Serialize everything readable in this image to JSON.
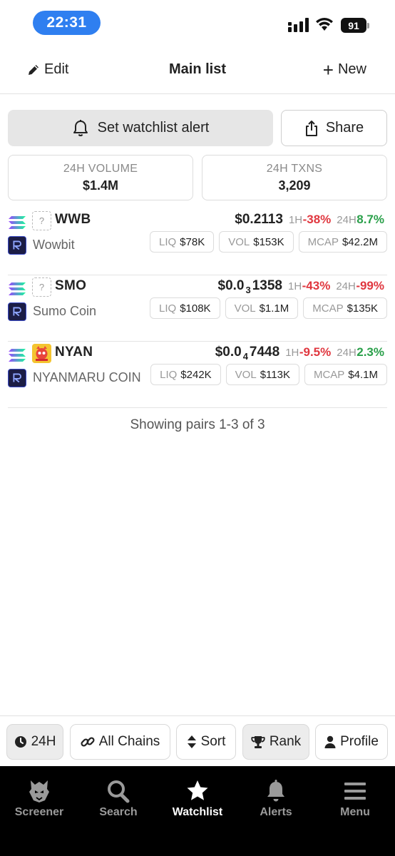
{
  "status_bar": {
    "time": "22:31",
    "battery": "91"
  },
  "header": {
    "edit_label": "Edit",
    "title": "Main list",
    "new_label": "New"
  },
  "actions": {
    "alert_label": "Set watchlist alert",
    "share_label": "Share"
  },
  "stats": [
    {
      "label": "24H VOLUME",
      "value": "$1.4M"
    },
    {
      "label": "24H TXNS",
      "value": "3,209"
    }
  ],
  "pairs": [
    {
      "symbol": "WWB",
      "name": "Wowbit",
      "price_main": "$0.2113",
      "price_sub": "",
      "price_tail": "",
      "h1_label": "1H",
      "h1_change": "-38%",
      "h24_label": "24H",
      "h24_change": "8.7%",
      "liq_label": "LIQ",
      "liq": "$78K",
      "vol_label": "VOL",
      "vol": "$153K",
      "mcap_label": "MCAP",
      "mcap": "$42.2M",
      "token_placeholder": "?"
    },
    {
      "symbol": "SMO",
      "name": "Sumo Coin",
      "price_main": "$0.0",
      "price_sub": "3",
      "price_tail": "1358",
      "h1_label": "1H",
      "h1_change": "-43%",
      "h24_label": "24H",
      "h24_change": "-99%",
      "liq_label": "LIQ",
      "liq": "$108K",
      "vol_label": "VOL",
      "vol": "$1.1M",
      "mcap_label": "MCAP",
      "mcap": "$135K",
      "token_placeholder": "?"
    },
    {
      "symbol": "NYAN",
      "name": "NYANMARU COIN",
      "price_main": "$0.0",
      "price_sub": "4",
      "price_tail": "7448",
      "h1_label": "1H",
      "h1_change": "-9.5%",
      "h24_label": "24H",
      "h24_change": "2.3%",
      "liq_label": "LIQ",
      "liq": "$242K",
      "vol_label": "VOL",
      "vol": "$113K",
      "mcap_label": "MCAP",
      "mcap": "$4.1M",
      "token_placeholder": ""
    }
  ],
  "footer_text": "Showing pairs 1-3 of 3",
  "filters": {
    "timeframe": "24H",
    "chains": "All Chains",
    "sort": "Sort",
    "rank": "Rank",
    "profile": "Profile"
  },
  "nav": {
    "screener": "Screener",
    "search": "Search",
    "watchlist": "Watchlist",
    "alerts": "Alerts",
    "menu": "Menu"
  },
  "colors": {
    "accent": "#2f7ff0",
    "negative": "#e0373f",
    "positive": "#2aa04a",
    "nav_bg": "#000000"
  },
  "icons": {
    "chain": "solana-icon",
    "dex": "raydium-icon",
    "edit": "pencil-icon",
    "alert": "bell-icon",
    "share": "share-icon",
    "timeframe": "clock-icon",
    "chains": "link-icon",
    "sort": "sort-icon",
    "rank": "trophy-icon",
    "profile": "user-icon"
  }
}
